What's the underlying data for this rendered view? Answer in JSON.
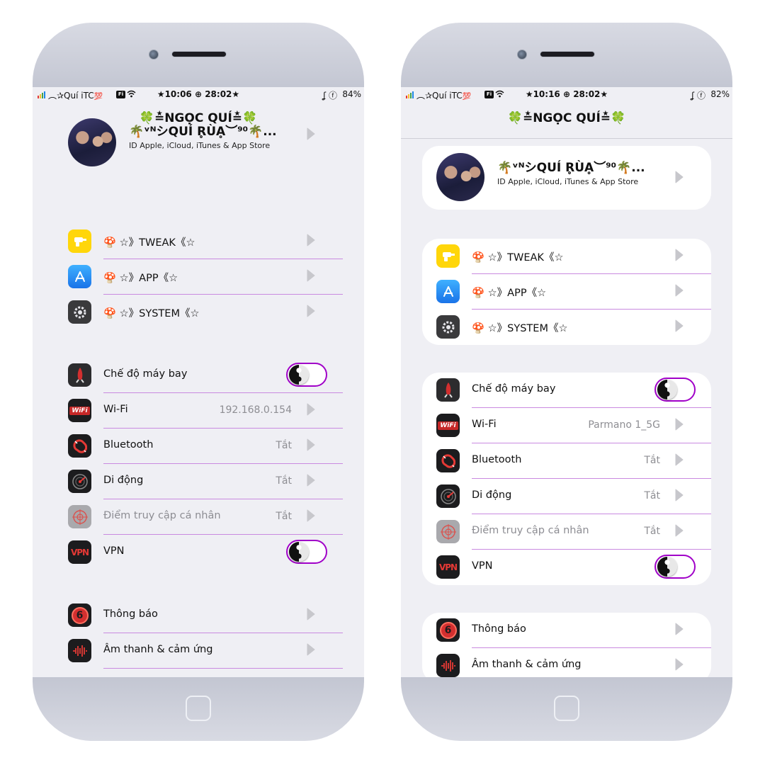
{
  "phones": [
    {
      "status": {
        "carrier": "︵✰Quí iTC",
        "carrier_extra": "💯",
        "time": "★10:06 ⊕ 28:02★",
        "fb": "ʆ ⓕ",
        "battery": "84%"
      },
      "title": "🍀≛NGỌC QUÍ≛🍀",
      "profile": {
        "name": "🌴ᵛᴺシQUÍ R̥ÙḀ︶⁹⁰🌴...",
        "subtitle": "ID Apple, iCloud, iTunes & App Store"
      },
      "group1": [
        {
          "label": "🍄 ☆》TWEAK《☆"
        },
        {
          "label": "🍄 ☆》APP《☆"
        },
        {
          "label": "🍄 ☆》SYSTEM《☆"
        }
      ],
      "group2": [
        {
          "label": "Chế độ máy bay",
          "value": ""
        },
        {
          "label": "Wi-Fi",
          "value": "192.168.0.154"
        },
        {
          "label": "Bluetooth",
          "value": "Tắt"
        },
        {
          "label": "Di động",
          "value": "Tắt"
        },
        {
          "label": "Điểm truy cập cá nhân",
          "value": "Tắt"
        },
        {
          "label": "VPN",
          "value": ""
        }
      ],
      "group3": [
        {
          "label": "Thông báo"
        },
        {
          "label": "Âm thanh & cảm ứng"
        }
      ]
    },
    {
      "status": {
        "carrier": "︵✰Quí iTC",
        "carrier_extra": "💯",
        "time": "★10:16 ⊕ 28:02★",
        "fb": "ʆ ⓕ",
        "battery": "82%"
      },
      "title": "🍀≛NGỌC QUÍ≛🍀",
      "profile": {
        "name": "🌴ᵛᴺシQUÍ R̥ÙḀ︶⁹⁰🌴...",
        "subtitle": "ID Apple, iCloud, iTunes & App Store"
      },
      "group1": [
        {
          "label": "🍄 ☆》TWEAK《☆"
        },
        {
          "label": "🍄 ☆》APP《☆"
        },
        {
          "label": "🍄 ☆》SYSTEM《☆"
        }
      ],
      "group2": [
        {
          "label": "Chế độ máy bay",
          "value": ""
        },
        {
          "label": "Wi-Fi",
          "value": "Parmano 1_5G"
        },
        {
          "label": "Bluetooth",
          "value": "Tắt"
        },
        {
          "label": "Di động",
          "value": "Tắt"
        },
        {
          "label": "Điểm truy cập cá nhân",
          "value": "Tắt"
        },
        {
          "label": "VPN",
          "value": ""
        }
      ],
      "group3": [
        {
          "label": "Thông báo"
        },
        {
          "label": "Âm thanh & cảm ứng"
        }
      ]
    }
  ],
  "icons": {
    "tweak": "drill-icon",
    "app": "app-store-icon",
    "system": "gear-icon",
    "airplane": "rocket-icon",
    "wifi": "wifi-icon",
    "bluetooth": "magnet-icon",
    "cellular": "radar-icon",
    "hotspot": "crosshair-icon",
    "vpn": "vpn-icon",
    "notifications": "notification-icon",
    "sounds": "sound-wave-icon"
  },
  "colors": {
    "accent": "#a000c8",
    "divider": "#c98ae0",
    "screen_bg": "#efeff4"
  },
  "toggles": {
    "airplane_mode": false,
    "vpn": false
  }
}
